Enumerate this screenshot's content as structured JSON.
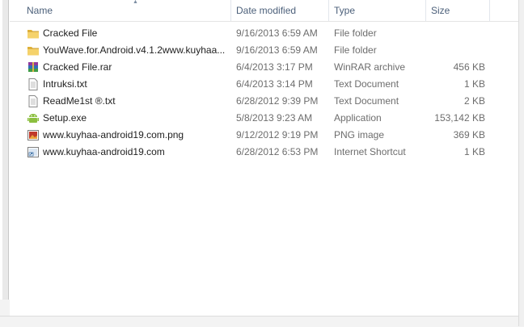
{
  "columns": {
    "name": "Name",
    "date_modified": "Date modified",
    "type": "Type",
    "size": "Size"
  },
  "files": [
    {
      "name": "Cracked File",
      "date": "9/16/2013 6:59 AM",
      "type": "File folder",
      "size": "",
      "icon": "folder-icon"
    },
    {
      "name": "YouWave.for.Android.v4.1.2www.kuyhaa...",
      "date": "9/16/2013 6:59 AM",
      "type": "File folder",
      "size": "",
      "icon": "folder-icon"
    },
    {
      "name": "Cracked File.rar",
      "date": "6/4/2013 3:17 PM",
      "type": "WinRAR archive",
      "size": "456 KB",
      "icon": "winrar-icon"
    },
    {
      "name": "Intruksi.txt",
      "date": "6/4/2013 3:14 PM",
      "type": "Text Document",
      "size": "1 KB",
      "icon": "text-document-icon"
    },
    {
      "name": "ReadMe1st ®.txt",
      "date": "6/28/2012 9:39 PM",
      "type": "Text Document",
      "size": "2 KB",
      "icon": "text-document-icon"
    },
    {
      "name": "Setup.exe",
      "date": "5/8/2013 9:23 AM",
      "type": "Application",
      "size": "153,142 KB",
      "icon": "android-setup-icon"
    },
    {
      "name": "www.kuyhaa-android19.com.png",
      "date": "9/12/2012 9:19 PM",
      "type": "PNG image",
      "size": "369 KB",
      "icon": "png-image-icon"
    },
    {
      "name": "www.kuyhaa-android19.com",
      "date": "6/28/2012 6:53 PM",
      "type": "Internet Shortcut",
      "size": "1 KB",
      "icon": "internet-shortcut-icon"
    }
  ]
}
